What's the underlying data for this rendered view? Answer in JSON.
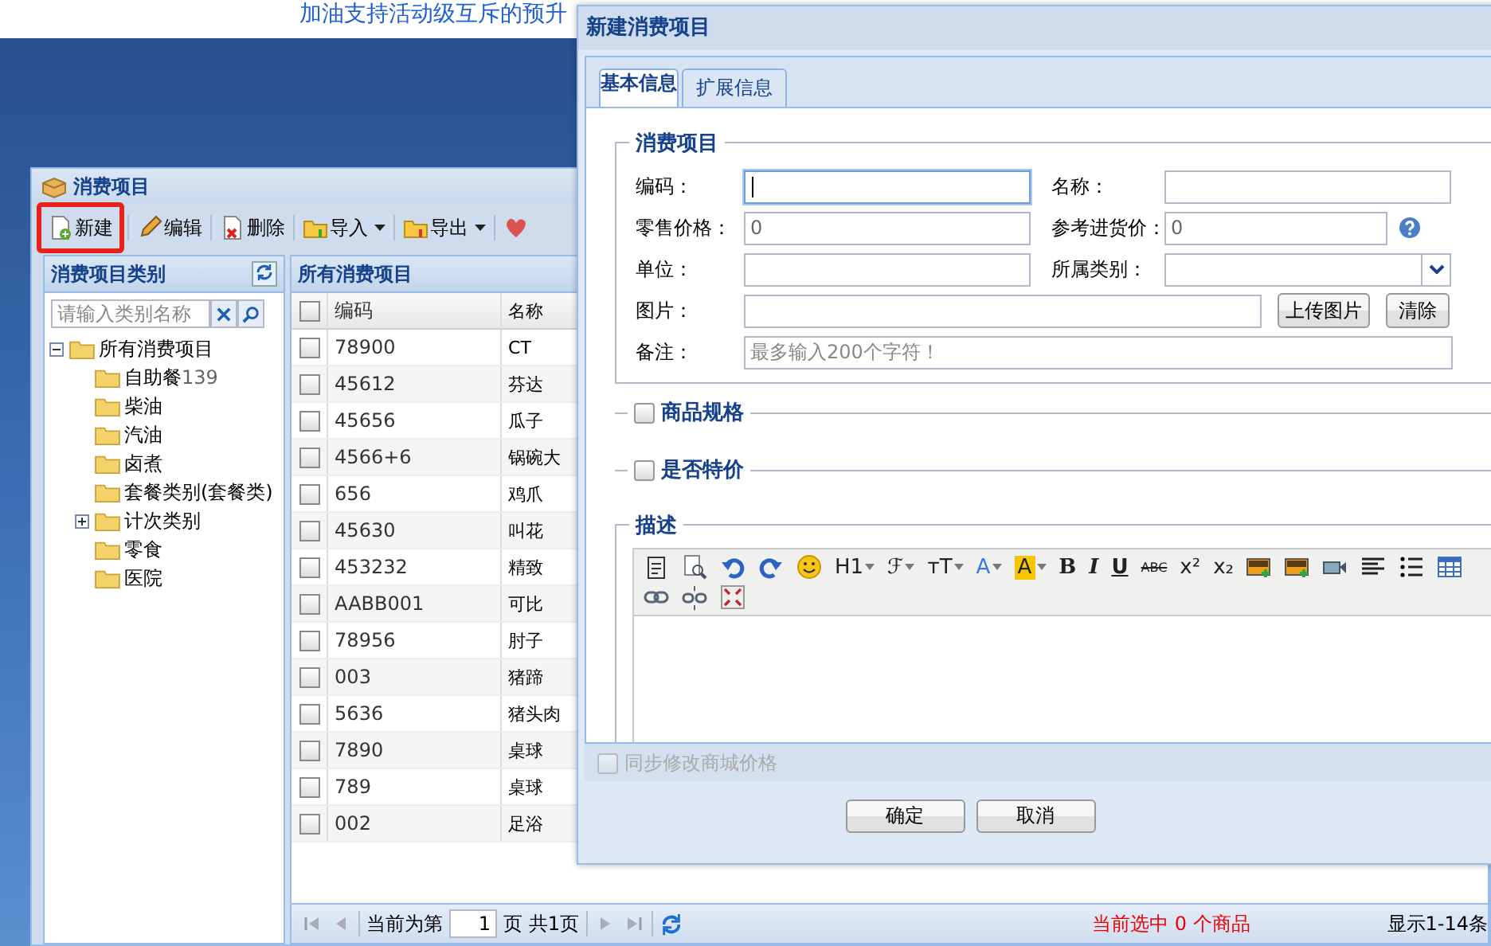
{
  "banner": {
    "text": "加油支持活动级互斥的预升"
  },
  "main_window": {
    "title": "消费项目",
    "toolbar": [
      {
        "label": "新建",
        "kind": "new",
        "highlighted": true,
        "dropdown": false
      },
      {
        "label": "编辑",
        "kind": "edit",
        "highlighted": false,
        "dropdown": false
      },
      {
        "label": "删除",
        "kind": "delete",
        "highlighted": false,
        "dropdown": false
      },
      {
        "label": "导入",
        "kind": "import",
        "highlighted": false,
        "dropdown": true
      },
      {
        "label": "导出",
        "kind": "export",
        "highlighted": false,
        "dropdown": true
      },
      {
        "kind": "heart",
        "highlighted": false,
        "dropdown": false
      }
    ],
    "category_panel": {
      "title": "消费项目类别",
      "search": {
        "placeholder": "请输入类别名称"
      },
      "tree": [
        {
          "label": "所有消费项目",
          "kind": "branch",
          "expanded": true,
          "children": [
            {
              "label": "自助餐",
              "count": "139",
              "kind": "leaf"
            },
            {
              "label": "柴油",
              "kind": "leaf"
            },
            {
              "label": "汽油",
              "kind": "leaf"
            },
            {
              "label": "卤煮",
              "kind": "leaf"
            },
            {
              "label": "套餐类别(套餐类)",
              "kind": "leaf"
            },
            {
              "label": "计次类别",
              "kind": "branch",
              "expanded": false
            },
            {
              "label": "零食",
              "kind": "leaf"
            },
            {
              "label": "医院",
              "kind": "leaf"
            }
          ]
        }
      ]
    },
    "items_panel": {
      "title": "所有消费项目",
      "columns": [
        "编码",
        "名称"
      ],
      "all_checked": false,
      "rows": [
        {
          "code": "78900",
          "name": "CT",
          "checked": false
        },
        {
          "code": "45612",
          "name": "芬达",
          "checked": false
        },
        {
          "code": "45656",
          "name": "瓜子",
          "checked": false
        },
        {
          "code": "4566+6",
          "name": "锅碗大",
          "checked": false
        },
        {
          "code": "656",
          "name": "鸡爪",
          "checked": false
        },
        {
          "code": "45630",
          "name": "叫花",
          "checked": false
        },
        {
          "code": "453232",
          "name": "精致",
          "checked": false
        },
        {
          "code": "AABB001",
          "name": "可比",
          "checked": false
        },
        {
          "code": "78956",
          "name": "肘子",
          "checked": false
        },
        {
          "code": "003",
          "name": "猪蹄",
          "checked": false
        },
        {
          "code": "5636",
          "name": "猪头肉",
          "checked": false
        },
        {
          "code": "7890",
          "name": "桌球",
          "checked": false
        },
        {
          "code": "789",
          "name": "桌球",
          "checked": false
        },
        {
          "code": "002",
          "name": "足浴",
          "checked": false
        }
      ]
    },
    "pager": {
      "before": "当前为第",
      "page": "1",
      "after": "页 共1页",
      "selection": "当前选中 0 个商品",
      "range": "显示1-14条"
    }
  },
  "dialog": {
    "title": "新建消费项目",
    "tabs": [
      {
        "label": "基本信息",
        "selected": true
      },
      {
        "label": "扩展信息",
        "selected": false
      }
    ],
    "fieldset": {
      "legend": "消费项目",
      "fields": [
        {
          "label": "编码：",
          "kind": "text",
          "focused": true
        },
        {
          "label": "名称：",
          "kind": "text",
          "focused": false
        },
        {
          "label": "零售价格：",
          "kind": "text",
          "value": "0",
          "focused": false
        },
        {
          "label": "参考进货价：",
          "kind": "help",
          "value": "0",
          "focused": false
        },
        {
          "label": "单位：",
          "kind": "text",
          "focused": false
        },
        {
          "label": "所属类别：",
          "kind": "select",
          "focused": false
        }
      ],
      "image": {
        "label": "图片：",
        "upload": "上传图片",
        "clear": "清除"
      },
      "note": {
        "label": "备注：",
        "placeholder": "最多输入200个字符！"
      }
    },
    "sections": [
      {
        "label": "商品规格",
        "checked": false
      },
      {
        "label": "是否特价",
        "checked": false
      }
    ],
    "description": {
      "legend": "描述",
      "tools": [
        {
          "kind": "paste"
        },
        {
          "kind": "preview"
        },
        {
          "kind": "undo"
        },
        {
          "kind": "redo"
        },
        {
          "kind": "smiley"
        },
        {
          "kind": "menu",
          "label": "H1"
        },
        {
          "kind": "menu",
          "label": "ℱ"
        },
        {
          "kind": "menu",
          "label": "тT"
        },
        {
          "kind": "color",
          "label": "A"
        },
        {
          "kind": "highlight",
          "label": "A"
        },
        {
          "kind": "bold",
          "label": "B"
        },
        {
          "kind": "italic",
          "label": "I"
        },
        {
          "kind": "underline",
          "label": "U"
        },
        {
          "kind": "strike",
          "label": "ABC"
        },
        {
          "kind": "sup",
          "label": "x²"
        },
        {
          "kind": "sub",
          "label": "x₂"
        },
        {
          "kind": "image"
        },
        {
          "kind": "images"
        },
        {
          "kind": "video"
        },
        {
          "kind": "align"
        },
        {
          "kind": "list"
        },
        {
          "kind": "table"
        },
        {
          "kind": "link"
        },
        {
          "kind": "unlink"
        },
        {
          "kind": "fullscreen"
        }
      ]
    },
    "sync": {
      "label": "同步修改商城价格",
      "checked": false,
      "disabled": true
    },
    "buttons": [
      "确定",
      "取消"
    ]
  }
}
